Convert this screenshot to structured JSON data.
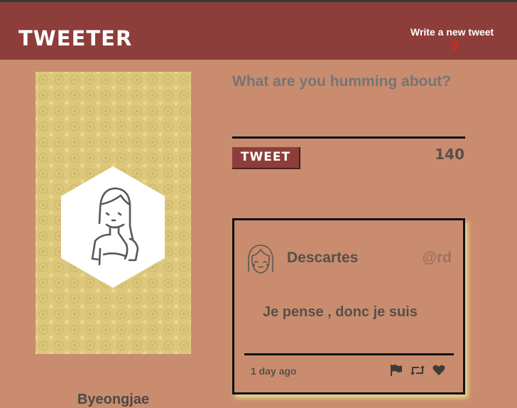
{
  "header": {
    "logo": "TWEETER",
    "compose_link": "Write a new tweet"
  },
  "profile": {
    "username": "Byeongjae"
  },
  "composer": {
    "placeholder": "What are you humming about?",
    "tweet_button": "TWEET",
    "counter": "140"
  },
  "tweet": {
    "author": "Descartes",
    "handle": "@rd",
    "text": "Je pense , donc je suis",
    "timestamp": "1 day ago"
  },
  "colors": {
    "background": "#c98c6f",
    "header": "#8d3e3a",
    "profile_panel": "#dcc77a",
    "text": "#58504a",
    "chevron": "#e3261e"
  },
  "icons": [
    "chevron-down-double-icon",
    "flag-icon",
    "retweet-icon",
    "heart-icon"
  ]
}
